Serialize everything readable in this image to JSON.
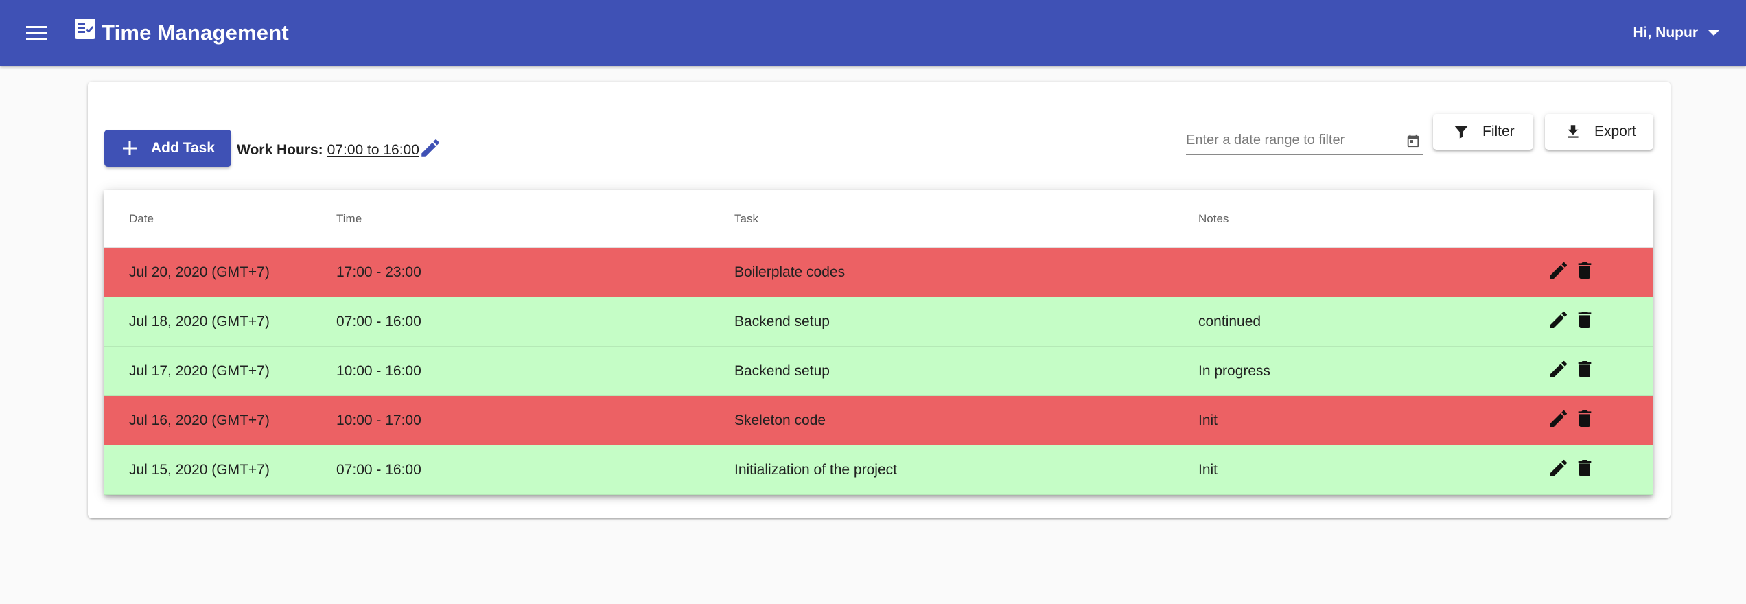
{
  "header": {
    "title": "Time Management",
    "greeting": "Hi, Nupur",
    "menu_icon": "menu-icon",
    "app_icon": "checklist-icon",
    "user_menu_icon": "arrow-drop-down-icon",
    "color": "#3f51b5"
  },
  "actions": {
    "add_task_label": "Add Task",
    "work_hours_label": "Work Hours:",
    "work_hours_value": "07:00 to 16:00",
    "date_filter_placeholder": "Enter a date range to filter",
    "filter_label": "Filter",
    "export_label": "Export"
  },
  "table": {
    "columns": [
      "Date",
      "Time",
      "Task",
      "Notes"
    ],
    "rows": [
      {
        "date": "Jul 20, 2020 (GMT+7)",
        "time": "17:00 - 23:00",
        "task": "Boilerplate codes",
        "notes": "",
        "status": "late"
      },
      {
        "date": "Jul 18, 2020 (GMT+7)",
        "time": "07:00 - 16:00",
        "task": "Backend setup",
        "notes": "continued",
        "status": "ok"
      },
      {
        "date": "Jul 17, 2020 (GMT+7)",
        "time": "10:00 - 16:00",
        "task": "Backend setup",
        "notes": "In progress",
        "status": "ok"
      },
      {
        "date": "Jul 16, 2020 (GMT+7)",
        "time": "10:00 - 17:00",
        "task": "Skeleton code",
        "notes": "Init",
        "status": "late"
      },
      {
        "date": "Jul 15, 2020 (GMT+7)",
        "time": "07:00 - 16:00",
        "task": "Initialization of the project",
        "notes": "Init",
        "status": "ok"
      }
    ],
    "status_colors": {
      "late": "#ec6164",
      "ok": "#c5fdc6"
    }
  }
}
